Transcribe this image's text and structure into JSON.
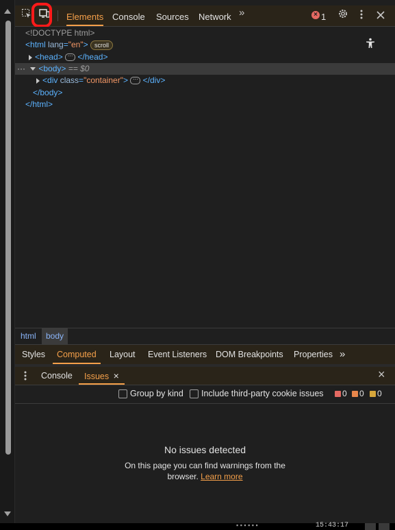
{
  "toolbar": {
    "tabs": [
      "Elements",
      "Console",
      "Sources",
      "Network"
    ],
    "more": "»",
    "error_count": "1",
    "error_badge": "×"
  },
  "dom": {
    "doctype": "<!DOCTYPE html>",
    "html_open_tag": "html",
    "html_attr_name": "lang",
    "html_attr_value": "\"en\"",
    "scroll_badge": "scroll",
    "head_open": "<head>",
    "head_close": "</head>",
    "body_open": "<body>",
    "body_ref": "== $0",
    "div_tag": "div",
    "div_attr_name": "class",
    "div_attr_value": "\"container\"",
    "div_close": "</div>",
    "body_close": "</body>",
    "html_close": "</html>",
    "ellipsis": "···"
  },
  "breadcrumbs": [
    "html",
    "body"
  ],
  "styles_tabs": [
    "Styles",
    "Computed",
    "Layout",
    "Event Listeners",
    "DOM Breakpoints",
    "Properties"
  ],
  "drawer": {
    "tabs": [
      "Console",
      "Issues"
    ],
    "close_tab": "×",
    "close": "×"
  },
  "issues": {
    "group_by_kind": "Group by kind",
    "third_party": "Include third-party cookie issues",
    "counts": [
      "0",
      "0",
      "0"
    ],
    "title": "No issues detected",
    "text": "On this page you can find warnings from the browser.",
    "learn_more": "Learn more"
  },
  "taskbar": {
    "time": "15:43:17"
  },
  "colors": {
    "accent": "#f5a04a",
    "error": "#e46962",
    "highlight_ring": "#ff1a1a"
  }
}
